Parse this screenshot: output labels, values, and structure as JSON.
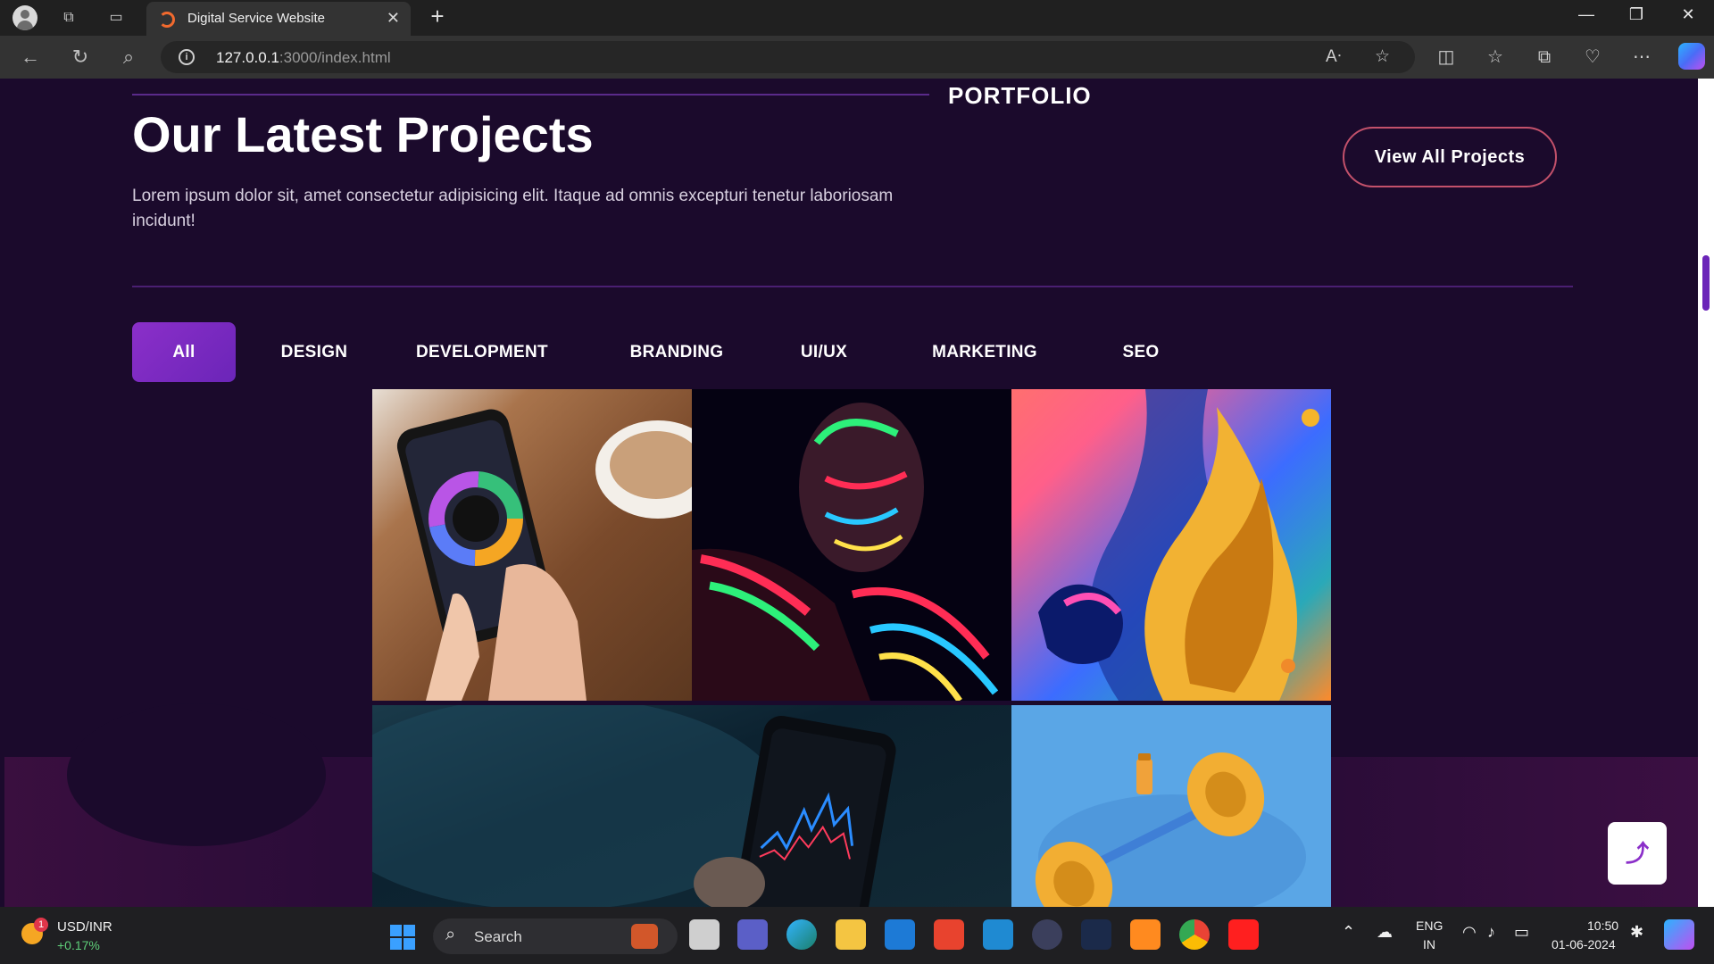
{
  "browser": {
    "tab_title": "Digital Service Website",
    "url_host": "127.0.0.1",
    "url_path": ":3000/index.html"
  },
  "section": {
    "eyebrow": "PORTFOLIO",
    "title": "Our Latest Projects",
    "description": "Lorem ipsum dolor sit, amet consectetur adipisicing elit. Itaque ad omnis excepturi tenetur laboriosam incidunt!",
    "cta_label": "View All Projects"
  },
  "filters": {
    "items": [
      {
        "label": "All",
        "active": true
      },
      {
        "label": "DESIGN"
      },
      {
        "label": "DEVELOPMENT"
      },
      {
        "label": "BRANDING"
      },
      {
        "label": "UI/UX"
      },
      {
        "label": "MARKETING"
      },
      {
        "label": "SEO"
      }
    ]
  },
  "gallery": {
    "tiles": [
      {
        "name": "expenses-phone-image"
      },
      {
        "name": "neon-bodypaint-image"
      },
      {
        "name": "fluid-art-image"
      },
      {
        "name": "stock-chart-phone-image"
      },
      {
        "name": "dumbbell-image"
      }
    ]
  },
  "scroll_top_icon": "⤴",
  "taskbar": {
    "stock_name": "USD/INR",
    "stock_change": "+0.17%",
    "badge_count": "1",
    "search_label": "Search",
    "lang": "ENG",
    "region": "IN",
    "time": "10:50",
    "date": "01-06-2024"
  },
  "colors": {
    "page_bg": "#1b0a2c",
    "accent": "#8b2fc9",
    "cta_border": "#c3516b"
  }
}
